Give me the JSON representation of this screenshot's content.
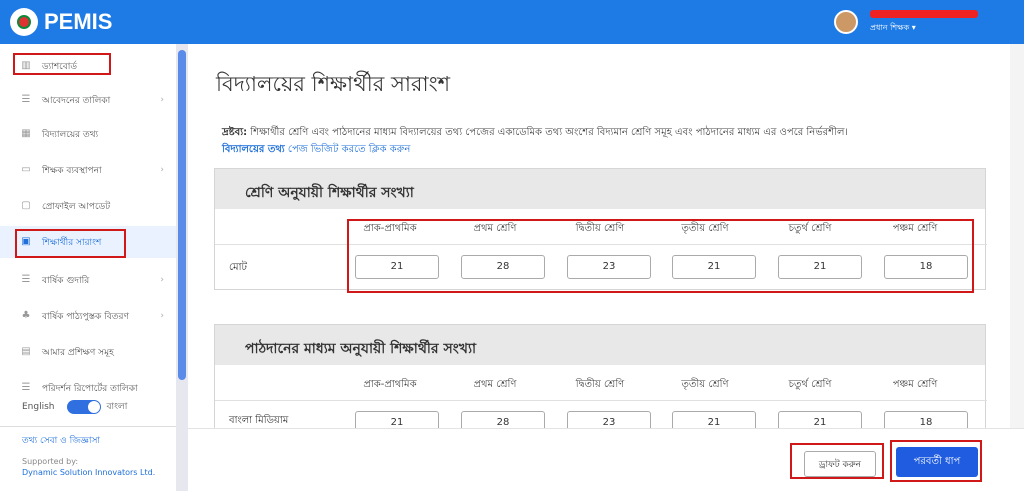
{
  "app": {
    "name": "PEMIS"
  },
  "user": {
    "role": "প্রধান শিক্ষক"
  },
  "sidebar": {
    "items": [
      {
        "label": "ড্যাশবোর্ড"
      },
      {
        "label": "আবেদনের তালিকা"
      },
      {
        "label": "বিদ্যালয়ের তথ্য"
      },
      {
        "label": "শিক্ষক ব্যবস্থাপনা"
      },
      {
        "label": "প্রোফাইল আপডেট"
      },
      {
        "label": "শিক্ষার্থীর সারাংশ"
      },
      {
        "label": "বার্ষিক গুদারি"
      },
      {
        "label": "বার্ষিক পাঠ্যপুস্তক বিতরণ"
      },
      {
        "label": "আমার প্রশিক্ষণ সমূহ"
      },
      {
        "label": "পরিদর্শন রিপোর্টের তালিকা"
      }
    ],
    "active_index": 5,
    "lang_en": "English",
    "lang_bn": "বাংলা",
    "help_link": "তথ্য সেবা ও জিজ্ঞাসা",
    "supported_by": "Supported by:",
    "company": "Dynamic Solution Innovators Ltd."
  },
  "main": {
    "title": "বিদ্যালয়ের শিক্ষার্থীর সারাংশ",
    "note_label": "দ্রষ্টব্য:",
    "note_text": "শিক্ষার্থীর শ্রেণি এবং পাঠদানের মাধ্যম বিদ্যালয়ের তথ্য পেজের একাডেমিক তথ্য অংশের বিদ্যমান শ্রেণি সমূহ এবং পাঠদানের মাধ্যম এর ওপরে নির্ভরশীল।",
    "note_link": "বিদ্যালয়ের তথ্য",
    "note_link_suffix": "পেজ ভিজিট করতে ক্লিক করুন",
    "classes": [
      "প্রাক-প্রাথমিক",
      "প্রথম শ্রেণি",
      "দ্বিতীয় শ্রেণি",
      "তৃতীয় শ্রেণি",
      "চতুর্থ শ্রেণি",
      "পঞ্চম শ্রেণি"
    ],
    "section1": {
      "title": "শ্রেণি অনুযায়ী শিক্ষার্থীর সংখ্যা",
      "row_label": "মোট",
      "values": [
        "21",
        "28",
        "23",
        "21",
        "21",
        "18"
      ]
    },
    "section2": {
      "title": "পাঠদানের মাধ্যম অনুযায়ী শিক্ষার্থীর সংখ্যা",
      "row_label": "বাংলা মিডিয়াম",
      "values": [
        "21",
        "28",
        "23",
        "21",
        "21",
        "18"
      ]
    }
  },
  "footer": {
    "draft_label": "ড্রাফট করুন",
    "next_label": "পরবর্তী ধাপ"
  }
}
